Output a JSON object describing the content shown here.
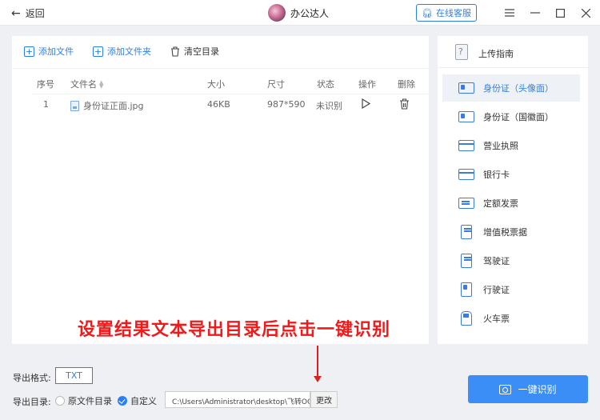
{
  "titlebar": {
    "back_label": "返回",
    "app_name": "办公达人",
    "service_label": "在线客服"
  },
  "toolbar": {
    "add_file": "添加文件",
    "add_folder": "添加文件夹",
    "clear_dir": "清空目录"
  },
  "table": {
    "headers": {
      "index": "序号",
      "name": "文件名",
      "size": "大小",
      "dims": "尺寸",
      "status": "状态",
      "action": "操作",
      "delete": "删除"
    },
    "rows": [
      {
        "index": "1",
        "name": "身份证正面.jpg",
        "size": "46KB",
        "dims": "987*590",
        "status": "未识别"
      }
    ]
  },
  "sidebar": {
    "title": "上传指南",
    "items": [
      {
        "label": "身份证（头像面）",
        "icon": "id-card-icon",
        "active": true
      },
      {
        "label": "身份证（国徽面）",
        "icon": "id-card-back-icon",
        "active": false
      },
      {
        "label": "营业执照",
        "icon": "business-license-icon",
        "active": false
      },
      {
        "label": "银行卡",
        "icon": "bank-card-icon",
        "active": false
      },
      {
        "label": "定额发票",
        "icon": "fixed-invoice-icon",
        "active": false
      },
      {
        "label": "增值税票据",
        "icon": "vat-invoice-icon",
        "active": false
      },
      {
        "label": "驾驶证",
        "icon": "driving-license-icon",
        "active": false
      },
      {
        "label": "行驶证",
        "icon": "vehicle-license-icon",
        "active": false
      },
      {
        "label": "火车票",
        "icon": "train-ticket-icon",
        "active": false
      }
    ]
  },
  "export": {
    "format_label": "导出格式:",
    "format_value": "TXT",
    "dir_label": "导出目录:",
    "option_original": "原文件目录",
    "option_custom": "自定义",
    "path": "C:\\Users\\Administrator\\desktop\\飞转OCR文",
    "change_label": "更改"
  },
  "recognize_label": "一键识别",
  "annotation": "设置结果文本导出目录后点击一键识别",
  "colors": {
    "accent": "#2b7ff0",
    "annotation": "#f11a1a"
  }
}
